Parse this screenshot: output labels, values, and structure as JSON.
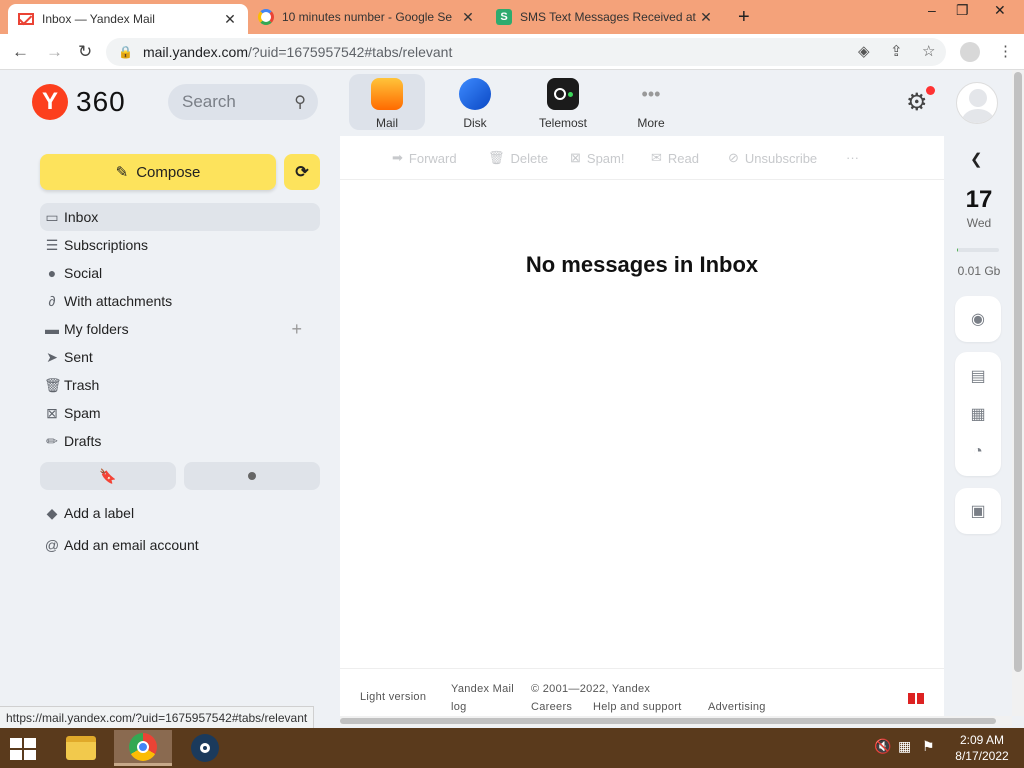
{
  "browser": {
    "tabs": [
      {
        "title": "Inbox — Yandex Mail",
        "favicon": "gmail-envelope-icon",
        "active": true
      },
      {
        "title": "10 minutes number - Google Se",
        "favicon": "google-g-icon",
        "active": false
      },
      {
        "title": "SMS Text Messages Received at",
        "favicon": "sms-s-icon",
        "active": false
      }
    ],
    "new_tab_glyph": "+",
    "window_controls": {
      "minimize": "–",
      "restore": "❐",
      "close": "✕"
    },
    "url_host": "mail.yandex.com",
    "url_rest": "/?uid=1675957542#tabs/relevant",
    "status_url": "https://mail.yandex.com/?uid=1675957542#tabs/relevant"
  },
  "header": {
    "logo_letter": "Y",
    "brand": "360",
    "search_placeholder": "Search",
    "services": [
      {
        "label": "Mail",
        "icon": "mail-envelope-icon",
        "color": "#ff8a00"
      },
      {
        "label": "Disk",
        "icon": "disk-cloud-icon",
        "color": "#1a6ff0"
      },
      {
        "label": "Telemost",
        "icon": "telemost-camera-icon",
        "color": "#1b1b1b"
      },
      {
        "label": "More",
        "icon": "more-dots-icon",
        "color": "#999999"
      }
    ]
  },
  "sidebar": {
    "compose_label": "Compose",
    "folders": [
      {
        "label": "Inbox",
        "icon": "inbox-icon",
        "active": true
      },
      {
        "label": "Subscriptions",
        "icon": "subscriptions-icon"
      },
      {
        "label": "Social",
        "icon": "social-chat-icon"
      },
      {
        "label": "With attachments",
        "icon": "paperclip-icon"
      },
      {
        "label": "My folders",
        "icon": "folder-icon"
      },
      {
        "label": "Sent",
        "icon": "sent-plane-icon"
      },
      {
        "label": "Trash",
        "icon": "trash-icon"
      },
      {
        "label": "Spam",
        "icon": "spam-icon"
      },
      {
        "label": "Drafts",
        "icon": "pencil-icon"
      }
    ],
    "add_label": "Add a label",
    "add_email_account": "Add an email account"
  },
  "toolbar": {
    "forward": "Forward",
    "delete": "Delete",
    "spam": "Spam!",
    "read": "Read",
    "unsubscribe": "Unsubscribe",
    "more": "···"
  },
  "main": {
    "empty_message": "No messages in Inbox"
  },
  "footer": {
    "light_version": "Light version",
    "yandex_mail_log_1": "Yandex Mail",
    "yandex_mail_log_2": "log",
    "copyright": "© 2001—2022, Yandex",
    "careers": "Careers",
    "help": "Help and support",
    "advertising": "Advertising"
  },
  "rail": {
    "day": "17",
    "weekday": "Wed",
    "quota": "0.01 Gb",
    "quota_fraction": 0.02
  },
  "taskbar": {
    "time": "2:09 AM",
    "date": "8/17/2022"
  }
}
